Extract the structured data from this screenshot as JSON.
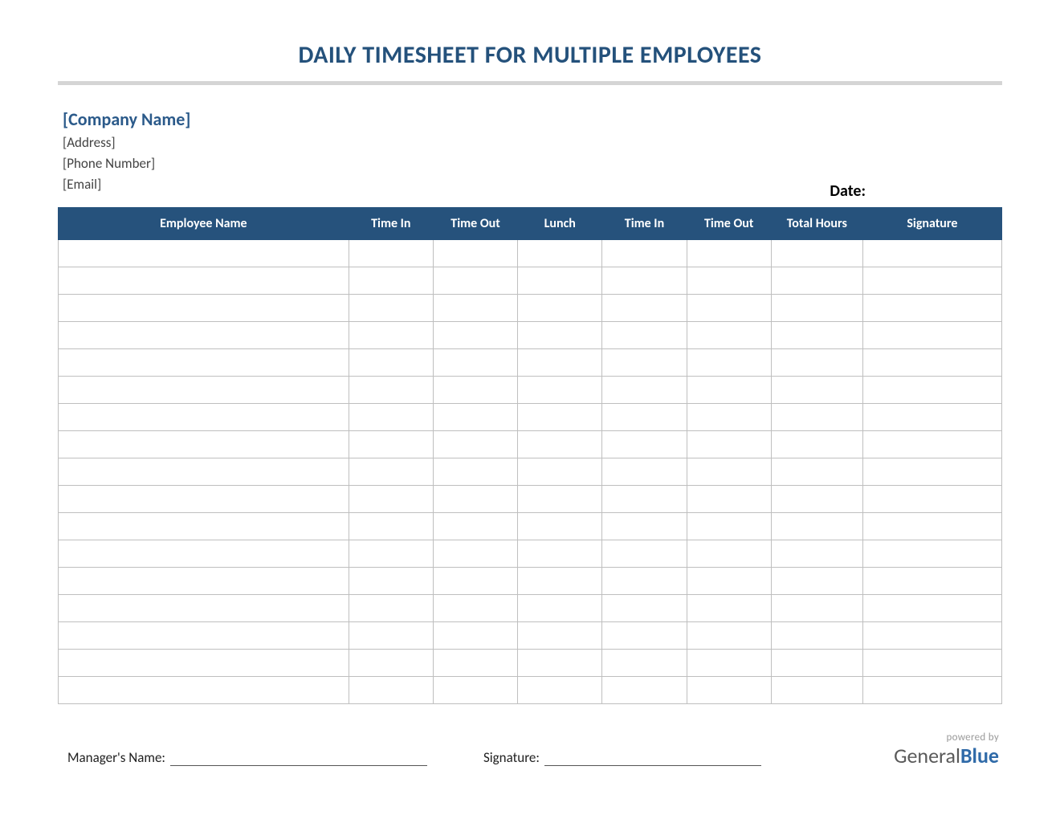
{
  "title": "DAILY TIMESHEET FOR MULTIPLE EMPLOYEES",
  "company": {
    "name": "[Company Name]",
    "address": "[Address]",
    "phone": "[Phone Number]",
    "email": "[Email]"
  },
  "date_label": "Date:",
  "columns": {
    "employee_name": "Employee Name",
    "time_in_1": "Time In",
    "time_out_1": "Time Out",
    "lunch": "Lunch",
    "time_in_2": "Time In",
    "time_out_2": "Time Out",
    "total_hours": "Total Hours",
    "signature": "Signature"
  },
  "row_count": 17,
  "footer": {
    "manager_label": "Manager's Name:",
    "signature_label": "Signature:"
  },
  "branding": {
    "powered_by": "powered by",
    "logo_part1": "General",
    "logo_part2": "Blue"
  }
}
